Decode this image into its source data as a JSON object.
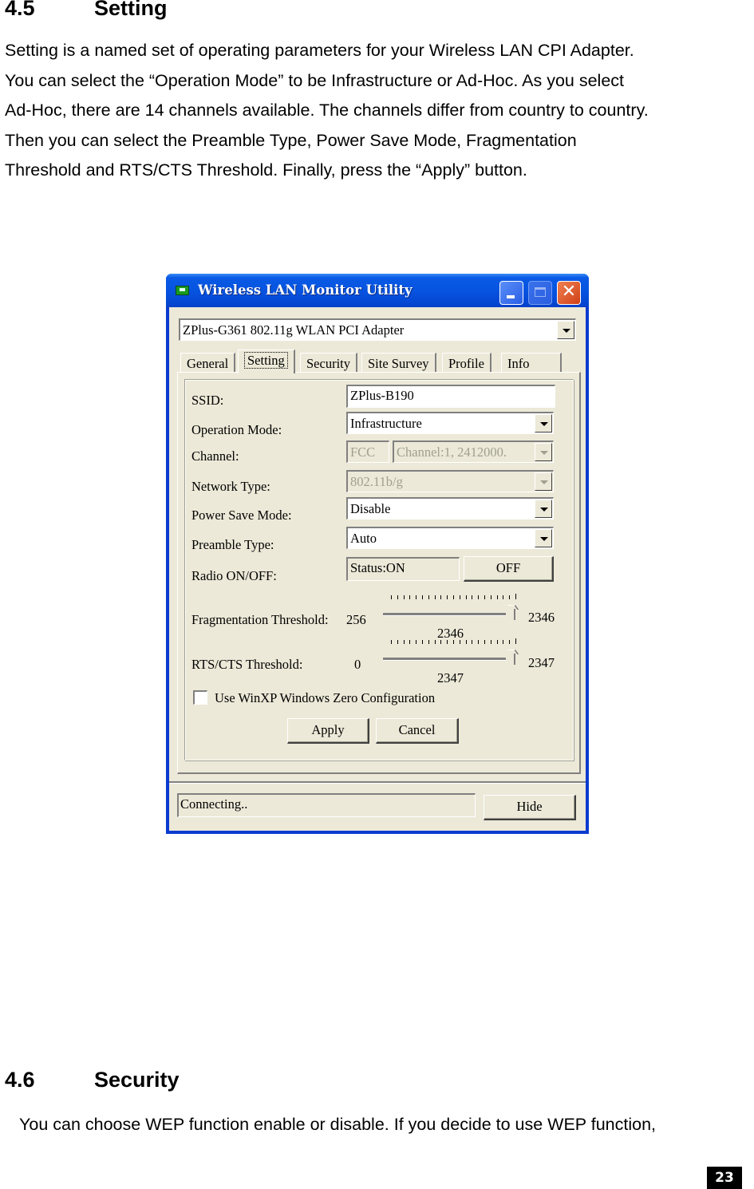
{
  "section_setting": {
    "number": "4.5",
    "title": "Setting",
    "paragraph_lines": [
      "Setting is a named set of operating parameters for your Wireless LAN CPI Adapter.",
      "You can select the “Operation Mode” to be Infrastructure or Ad-Hoc. As you select",
      "Ad-Hoc, there are 14 channels available. The channels differ from country to country.",
      "Then you can select the Preamble Type, Power Save Mode, Fragmentation",
      "Threshold and RTS/CTS Threshold. Finally, press the “Apply” button."
    ]
  },
  "window": {
    "title": "Wireless LAN Monitor Utility",
    "icon": "network-card-icon",
    "controls": {
      "minimize": "minimize-icon",
      "maximize": "maximize-icon",
      "close_glyph": "✕"
    },
    "adapter_select": "ZPlus-G361 802.11g WLAN PCI Adapter",
    "tabs": [
      {
        "label": "General",
        "active": false
      },
      {
        "label": "Setting",
        "active": true
      },
      {
        "label": "Security",
        "active": false
      },
      {
        "label": "Site Survey",
        "active": false
      },
      {
        "label": "Profile",
        "active": false
      },
      {
        "label": "Info",
        "active": false
      }
    ],
    "settings": {
      "ssid": {
        "label": "SSID:",
        "value": "ZPlus-B190"
      },
      "operation_mode": {
        "label": "Operation Mode:",
        "value": "Infrastructure"
      },
      "channel": {
        "label": "Channel:",
        "region": "FCC",
        "value": "Channel:1, 2412000.",
        "disabled": true
      },
      "network_type": {
        "label": "Network Type:",
        "value": "802.11b/g",
        "disabled": true
      },
      "power_save_mode": {
        "label": "Power Save Mode:",
        "value": "Disable"
      },
      "preamble_type": {
        "label": "Preamble Type:",
        "value": "Auto"
      },
      "radio": {
        "label": "Radio ON/OFF:",
        "status": "Status:ON",
        "button": "OFF"
      },
      "fragmentation": {
        "label": "Fragmentation Threshold:",
        "min": "256",
        "max": "2346",
        "value": "2346",
        "fraction": 1.0
      },
      "rts_cts": {
        "label": "RTS/CTS Threshold:",
        "min": "0",
        "max": "2347",
        "value": "2347",
        "fraction": 1.0
      },
      "zero_config": {
        "label": "Use WinXP Windows Zero Configuration",
        "checked": false
      }
    },
    "buttons": {
      "apply": "Apply",
      "cancel": "Cancel",
      "hide": "Hide"
    },
    "status": "Connecting.."
  },
  "section_security": {
    "number": "4.6",
    "title": "Security",
    "paragraph": "You can choose WEP function enable or disable. If you decide to use WEP function,"
  },
  "page_number": "23"
}
